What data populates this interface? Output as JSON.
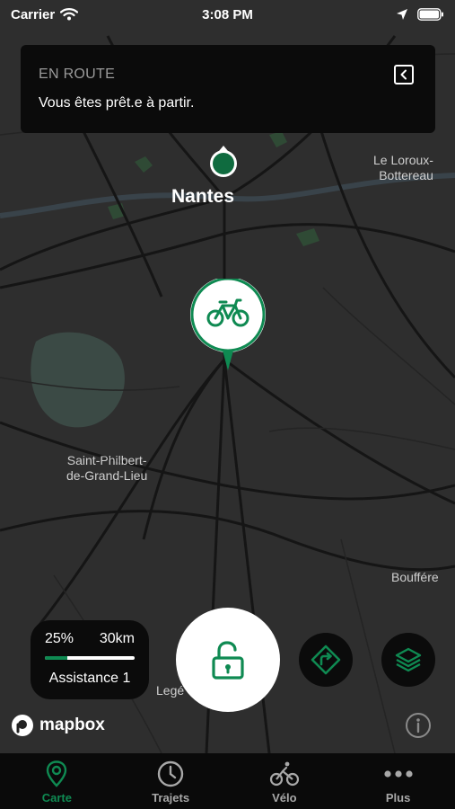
{
  "status_bar": {
    "carrier": "Carrier",
    "time": "3:08 PM"
  },
  "banner": {
    "title": "EN ROUTE",
    "message": "Vous êtes prêt.e à partir."
  },
  "map": {
    "labels": {
      "nantes": "Nantes",
      "loroux": "Le Loroux-\nBottereau",
      "stphilbert": "Saint-Philbert-\nde-Grand-Lieu",
      "bouffere": "Bouffére",
      "lege": "Legé"
    },
    "attribution": "mapbox"
  },
  "assistance": {
    "battery": "25%",
    "range": "30km",
    "battery_level": 0.25,
    "label": "Assistance 1"
  },
  "tabs": [
    {
      "label": "Carte",
      "icon": "map-pin-icon",
      "active": true
    },
    {
      "label": "Trajets",
      "icon": "clock-icon",
      "active": false
    },
    {
      "label": "Vélo",
      "icon": "cyclist-icon",
      "active": false
    },
    {
      "label": "Plus",
      "icon": "more-icon",
      "active": false
    }
  ],
  "colors": {
    "accent": "#0f8a52",
    "panel": "#0b0b0b",
    "map_bg": "#2e2e2e"
  }
}
